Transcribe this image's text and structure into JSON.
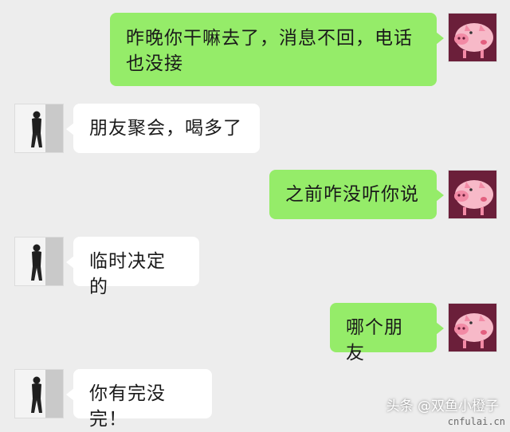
{
  "chat": {
    "messages": [
      {
        "sender": "me",
        "text": "昨晚你干嘛去了，消息不回，电话也没接"
      },
      {
        "sender": "friend",
        "text": "朋友聚会，喝多了"
      },
      {
        "sender": "me",
        "text": "之前咋没听你说"
      },
      {
        "sender": "friend",
        "text": "临时决定的"
      },
      {
        "sender": "me",
        "text": "哪个朋友"
      },
      {
        "sender": "friend",
        "text": "你有完没完！"
      }
    ]
  },
  "attribution": "头条 @双鱼小橙子",
  "watermark": "cnfulai.cn",
  "icons": {
    "my_avatar": "pink-pig-avatar-icon",
    "friend_avatar": "man-photo-avatar-icon"
  },
  "colors": {
    "background": "#ededed",
    "sent_bubble": "#95ec69",
    "received_bubble": "#ffffff"
  }
}
